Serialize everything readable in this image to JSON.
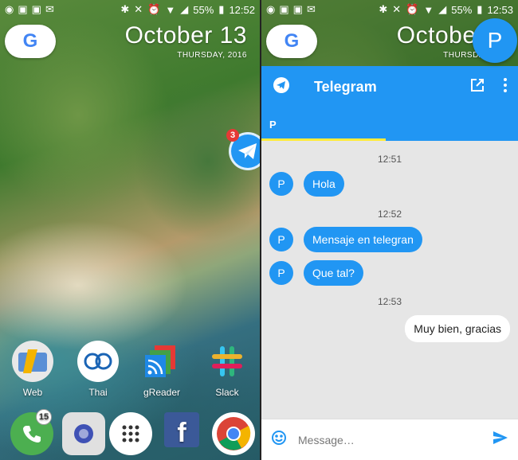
{
  "left_screen": {
    "status": {
      "battery": "55%",
      "time": "12:52"
    },
    "google_label": "G",
    "date": {
      "day": "October 13",
      "weekday": "THURSDAY, 2016"
    },
    "floating_bubble": {
      "badge": "3"
    },
    "apps": [
      {
        "label": "Web"
      },
      {
        "label": "Thai"
      },
      {
        "label": "gReader"
      },
      {
        "label": "Slack"
      }
    ],
    "dock": {
      "phone_badge": "15"
    }
  },
  "right_screen": {
    "status": {
      "battery": "55%",
      "time": "12:53"
    },
    "google_label": "G",
    "date": {
      "day": "October",
      "weekday": "THURSDA"
    },
    "avatar_letter": "P",
    "telegram": {
      "title": "Telegram",
      "tab_label": "P",
      "messages": [
        {
          "type": "time",
          "text": "12:51"
        },
        {
          "type": "in",
          "avatar": "P",
          "text": "Hola"
        },
        {
          "type": "time",
          "text": "12:52"
        },
        {
          "type": "in",
          "avatar": "P",
          "text": "Mensaje en telegran"
        },
        {
          "type": "in",
          "avatar": "P",
          "text": "Que tal?"
        },
        {
          "type": "time",
          "text": "12:53"
        },
        {
          "type": "out",
          "text": "Muy bien, gracias"
        }
      ],
      "composer_placeholder": "Message…"
    }
  },
  "colors": {
    "telegram_blue": "#2196F3",
    "tab_indicator": "#ffeb3b",
    "chat_bg": "#e6e6e6"
  }
}
